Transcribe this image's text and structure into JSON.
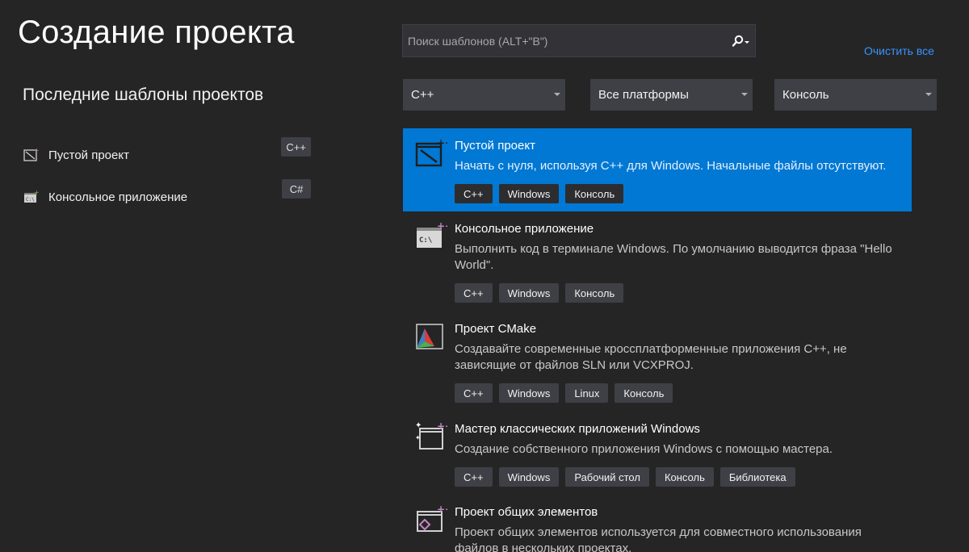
{
  "page": {
    "title": "Создание проекта"
  },
  "recent": {
    "heading": "Последние шаблоны проектов",
    "items": [
      {
        "label": "Пустой проект",
        "lang": "C++",
        "icon": "empty-project-icon"
      },
      {
        "label": "Консольное приложение",
        "lang": "C#",
        "icon": "console-app-icon"
      }
    ]
  },
  "search": {
    "placeholder": "Поиск шаблонов (ALT+\"В\")",
    "value": ""
  },
  "clear_all": "Очистить все",
  "filters": {
    "language": "C++",
    "platform": "Все платформы",
    "project_type": "Консоль"
  },
  "templates": [
    {
      "name": "Пустой проект",
      "desc": "Начать с нуля, используя C++ для Windows. Начальные файлы отсутствуют.",
      "tags": [
        "C++",
        "Windows",
        "Консоль"
      ],
      "selected": true,
      "icon": "empty-project-icon"
    },
    {
      "name": "Консольное приложение",
      "desc": "Выполнить код в терминале Windows. По умолчанию выводится фраза \"Hello World\".",
      "tags": [
        "C++",
        "Windows",
        "Консоль"
      ],
      "selected": false,
      "icon": "console-app-icon"
    },
    {
      "name": "Проект CMake",
      "desc": "Создавайте современные кроссплатформенные приложения C++, не зависящие от файлов SLN или VCXPROJ.",
      "tags": [
        "C++",
        "Windows",
        "Linux",
        "Консоль"
      ],
      "selected": false,
      "icon": "cmake-icon"
    },
    {
      "name": "Мастер классических приложений Windows",
      "desc": "Создание собственного приложения Windows с помощью мастера.",
      "tags": [
        "C++",
        "Windows",
        "Рабочий стол",
        "Консоль",
        "Библиотека"
      ],
      "selected": false,
      "icon": "wizard-icon"
    },
    {
      "name": "Проект общих элементов",
      "desc": "Проект общих элементов используется для совместного использования файлов в нескольких проектах.",
      "tags": [],
      "selected": false,
      "icon": "shared-items-icon"
    }
  ],
  "colors": {
    "background": "#252526",
    "selected": "#0078d4",
    "link": "#3794ff",
    "tag": "#3f3f46",
    "accent_plus": "#c586c0"
  }
}
